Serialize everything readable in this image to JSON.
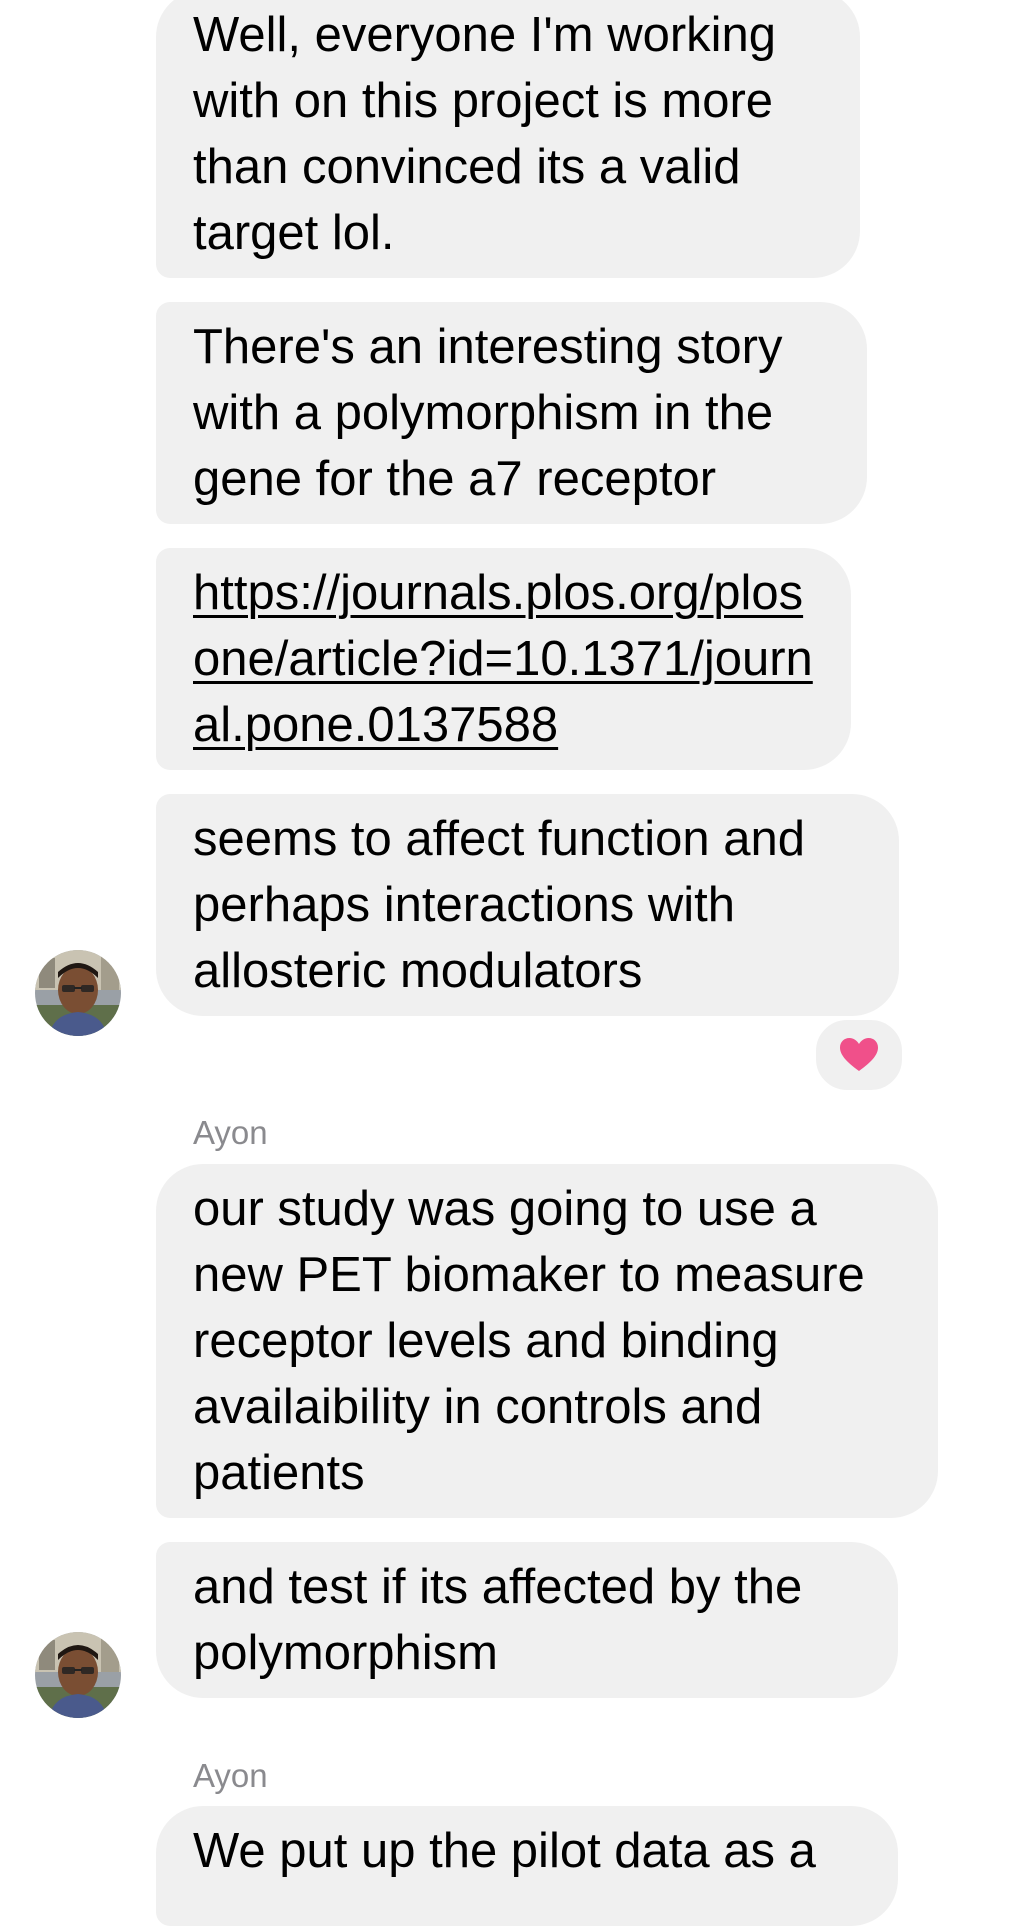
{
  "thread": {
    "messages": [
      {
        "text": "Well, everyone I'm working with on this project is more than convinced its a valid target lol."
      },
      {
        "text": "There's an interesting story with a polymorphism in the gene for the a7 receptor"
      },
      {
        "link": "https://journals.plos.org/plosone/article?id=10.1371/journal.pone.0137588"
      },
      {
        "text": "seems to affect function and perhaps interactions with allosteric modulators",
        "reaction": "heart-icon"
      },
      {
        "sender": "Ayon",
        "text": "our study was going to use a new PET biomaker to measure receptor levels and binding availaibility in controls and patients"
      },
      {
        "text": "and test if its affected by the polymorphism"
      },
      {
        "sender": "Ayon",
        "text": "We put up the pilot data as a"
      }
    ]
  },
  "colors": {
    "bubble": "#f0f0f0",
    "sender": "#8a8a8e",
    "reaction_heart": "#f0508a"
  }
}
